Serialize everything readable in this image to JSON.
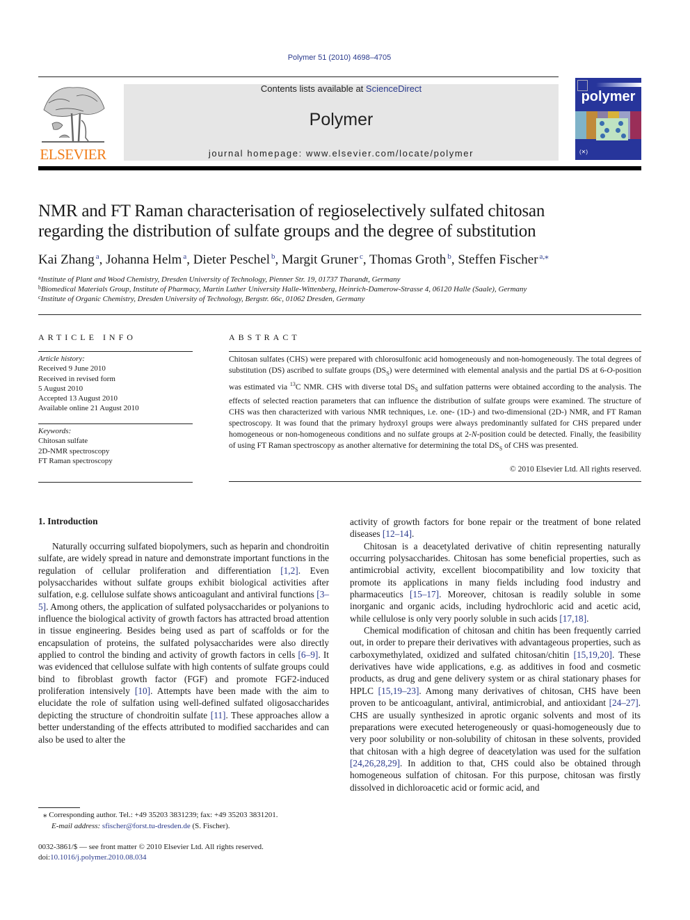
{
  "header": {
    "journal_reference": "Polymer 51 (2010) 4698–4705",
    "contents_prefix": "Contents lists available at ",
    "contents_link": "ScienceDirect",
    "journal_title": "Polymer",
    "homepage": "journal homepage: www.elsevier.com/locate/polymer",
    "publisher_logo_text": "ELSEVIER",
    "cover_title": "polymer",
    "colors": {
      "publisher_orange": "#f07c18",
      "link_blue": "#2a3a8c",
      "cover_blue": "#27359b",
      "masthead_gray": "#e6e6e6"
    }
  },
  "article": {
    "title_line1": "NMR and FT Raman characterisation of regioselectively sulfated chitosan",
    "title_line2": "regarding the distribution of sulfate groups and the degree of substitution",
    "authors": [
      {
        "name": "Kai Zhang",
        "sup": "a",
        "sep": ", "
      },
      {
        "name": "Johanna Helm",
        "sup": "a",
        "sep": ", "
      },
      {
        "name": "Dieter Peschel",
        "sup": "b",
        "sep": ", "
      },
      {
        "name": "Margit Gruner",
        "sup": "c",
        "sep": ", "
      },
      {
        "name": "Thomas Groth",
        "sup": "b",
        "sep": ", "
      },
      {
        "name": "Steffen Fischer",
        "sup": "a,⁎",
        "sep": ""
      }
    ],
    "affiliations": [
      {
        "sup": "a",
        "text": "Institute of Plant and Wood Chemistry, Dresden University of Technology, Pienner Str. 19, 01737 Tharandt, Germany"
      },
      {
        "sup": "b",
        "text": "Biomedical Materials Group, Institute of Pharmacy, Martin Luther University Halle-Wittenberg, Heinrich-Damerow-Strasse 4, 06120 Halle (Saale), Germany"
      },
      {
        "sup": "c",
        "text": "Institute of Organic Chemistry, Dresden University of Technology, Bergstr. 66c, 01062 Dresden, Germany"
      }
    ]
  },
  "article_info": {
    "heading": "ARTICLE INFO",
    "history_label": "Article history:",
    "history": [
      "Received 9 June 2010",
      "Received in revised form",
      "5 August 2010",
      "Accepted 13 August 2010",
      "Available online 21 August 2010"
    ],
    "keywords_label": "Keywords:",
    "keywords": [
      "Chitosan sulfate",
      "2D-NMR spectroscopy",
      "FT Raman spectroscopy"
    ]
  },
  "abstract": {
    "heading": "ABSTRACT",
    "parts": {
      "p1": "Chitosan sulfates (CHS) were prepared with chlorosulfonic acid homogeneously and non-homogeneously. The total degrees of substitution (DS) ascribed to sulfate groups (DS",
      "sub": "S",
      "p2": ") were determined with elemental analysis and the partial DS at 6-",
      "o_italic": "O",
      "p3": "-position was estimated via ",
      "sup13": "13",
      "p4": "C NMR. CHS with diverse total DS",
      "p5": " and sulfation patterns were obtained according to the analysis. The effects of selected reaction parameters that can influence the distribution of sulfate groups were examined. The structure of CHS was then characterized with various NMR techniques, i.e. one- (1D-) and two-dimensional (2D-) NMR, and FT Raman spectroscopy. It was found that the primary hydroxyl groups were always predominantly sulfated for CHS prepared under homogeneous or non-homogeneous conditions and no sulfate groups at 2-",
      "n_italic": "N",
      "p6": "-position could be detected. Finally, the feasibility of using FT Raman spectroscopy as another alternative for determining the total DS",
      "p7": " of CHS was presented."
    },
    "copyright": "© 2010 Elsevier Ltd. All rights reserved."
  },
  "body": {
    "section_heading": "1.  Introduction",
    "left_col": [
      {
        "t": "Naturally occurring sulfated biopolymers, such as heparin and chondroitin sulfate, are widely spread in nature and demonstrate important functions in the regulation of cellular proliferation and differentiation "
      },
      {
        "ref": "[1,2]"
      },
      {
        "t": ". Even polysaccharides without sulfate groups exhibit biological activities after sulfation, e.g. cellulose sulfate shows anticoagulant and antiviral functions "
      },
      {
        "ref": "[3–5]"
      },
      {
        "t": ". Among others, the application of sulfated polysaccharides or polyanions to influence the biological activity of growth factors has attracted broad attention in tissue engineering. Besides being used as part of scaffolds or for the encapsulation of proteins, the sulfated polysaccharides were also directly applied to control the binding and activity of growth factors in cells "
      },
      {
        "ref": "[6–9]"
      },
      {
        "t": ". It was evidenced that cellulose sulfate with high contents of sulfate groups could bind to fibroblast growth factor (FGF) and promote FGF2-induced proliferation intensively "
      },
      {
        "ref": "[10]"
      },
      {
        "t": ". Attempts have been made with the aim to elucidate the role of sulfation using well-defined sulfated oligosaccharides depicting the structure of chondroitin sulfate "
      },
      {
        "ref": "[11]"
      },
      {
        "t": ". These approaches allow a better understanding of the effects attributed to modified saccharides and can also be used to alter the"
      }
    ],
    "right_col_p1": [
      {
        "t": "activity of growth factors for bone repair or the treatment of bone related diseases "
      },
      {
        "ref": "[12–14]"
      },
      {
        "t": "."
      }
    ],
    "right_col_p2": [
      {
        "t": "Chitosan is a deacetylated derivative of chitin representing naturally occurring polysaccharides. Chitosan has some beneficial properties, such as antimicrobial activity, excellent biocompatibility and low toxicity that promote its applications in many fields including food industry and pharmaceutics "
      },
      {
        "ref": "[15–17]"
      },
      {
        "t": ". Moreover, chitosan is readily soluble in some inorganic and organic acids, including hydrochloric acid and acetic acid, while cellulose is only very poorly soluble in such acids "
      },
      {
        "ref": "[17,18]"
      },
      {
        "t": "."
      }
    ],
    "right_col_p3": [
      {
        "t": "Chemical modification of chitosan and chitin has been frequently carried out, in order to prepare their derivatives with advantageous properties, such as carboxymethylated, oxidized and sulfated chitosan/chitin "
      },
      {
        "ref": "[15,19,20]"
      },
      {
        "t": ". These derivatives have wide applications, e.g. as additives in food and cosmetic products, as drug and gene delivery system or as chiral stationary phases for HPLC "
      },
      {
        "ref": "[15,19–23]"
      },
      {
        "t": ". Among many derivatives of chitosan, CHS have been proven to be anticoagulant, antiviral, antimicrobial, and antioxidant "
      },
      {
        "ref": "[24–27]"
      },
      {
        "t": ". CHS are usually synthesized in aprotic organic solvents and most of its preparations were executed heterogeneously or quasi-homogeneously due to very poor solubility or non-solubility of chitosan in these solvents, provided that chitosan with a high degree of deacetylation was used for the sulfation "
      },
      {
        "ref": "[24,26,28,29]"
      },
      {
        "t": ". In addition to that, CHS could also be obtained through homogeneous sulfation of chitosan. For this purpose, chitosan was firstly dissolved in dichloroacetic acid or formic acid, and"
      }
    ]
  },
  "footnotes": {
    "corresponding": "⁎  Corresponding author. Tel.: +49 35203 3831239; fax: +49 35203 3831201.",
    "email_label": "E-mail address:",
    "email": "sfischer@forst.tu-dresden.de",
    "email_suffix": " (S. Fischer).",
    "front_matter": "0032-3861/$ — see front matter © 2010 Elsevier Ltd. All rights reserved.",
    "doi_prefix": "doi:",
    "doi": "10.1016/j.polymer.2010.08.034"
  }
}
